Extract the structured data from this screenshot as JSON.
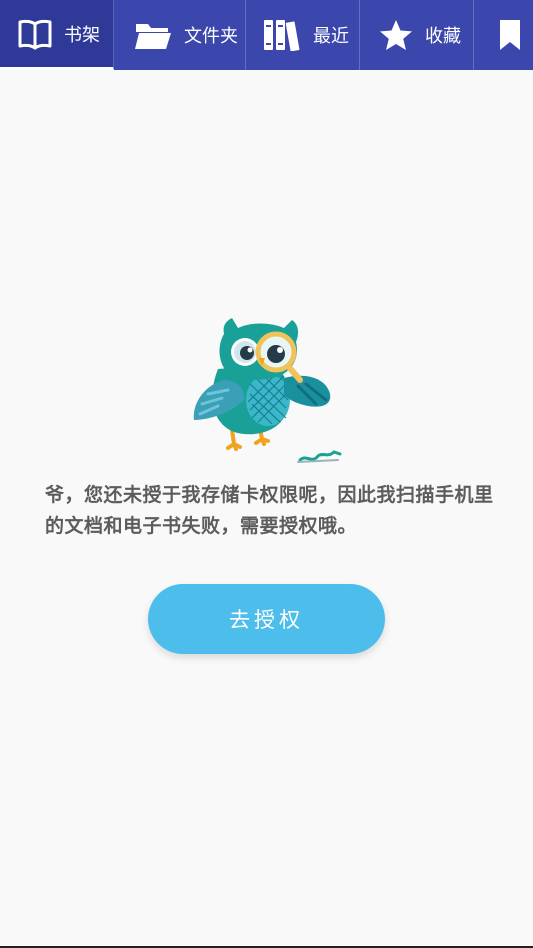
{
  "tabs": [
    {
      "id": "shelf",
      "label": "书架",
      "icon": "open-book-icon",
      "active": true
    },
    {
      "id": "folder",
      "label": "文件夹",
      "icon": "folder-icon",
      "active": false
    },
    {
      "id": "recent",
      "label": "最近",
      "icon": "books-icon",
      "active": false
    },
    {
      "id": "favorites",
      "label": "收藏",
      "icon": "star-icon",
      "active": false
    },
    {
      "id": "bookmarks",
      "label": "",
      "icon": "bookmark-icon",
      "active": false
    }
  ],
  "colors": {
    "tabbar": "#3b47ad",
    "button": "#4dbeec",
    "owl_primary": "#1aa197",
    "magnifier_rim": "#f0c35a"
  },
  "main": {
    "illustration": "owl-with-magnifier-icon",
    "message": "爷，您还未授于我存储卡权限呢，因此我扫描手机里的文档和电子书失败，需要授权哦。",
    "auth_button_label": "去授权"
  }
}
